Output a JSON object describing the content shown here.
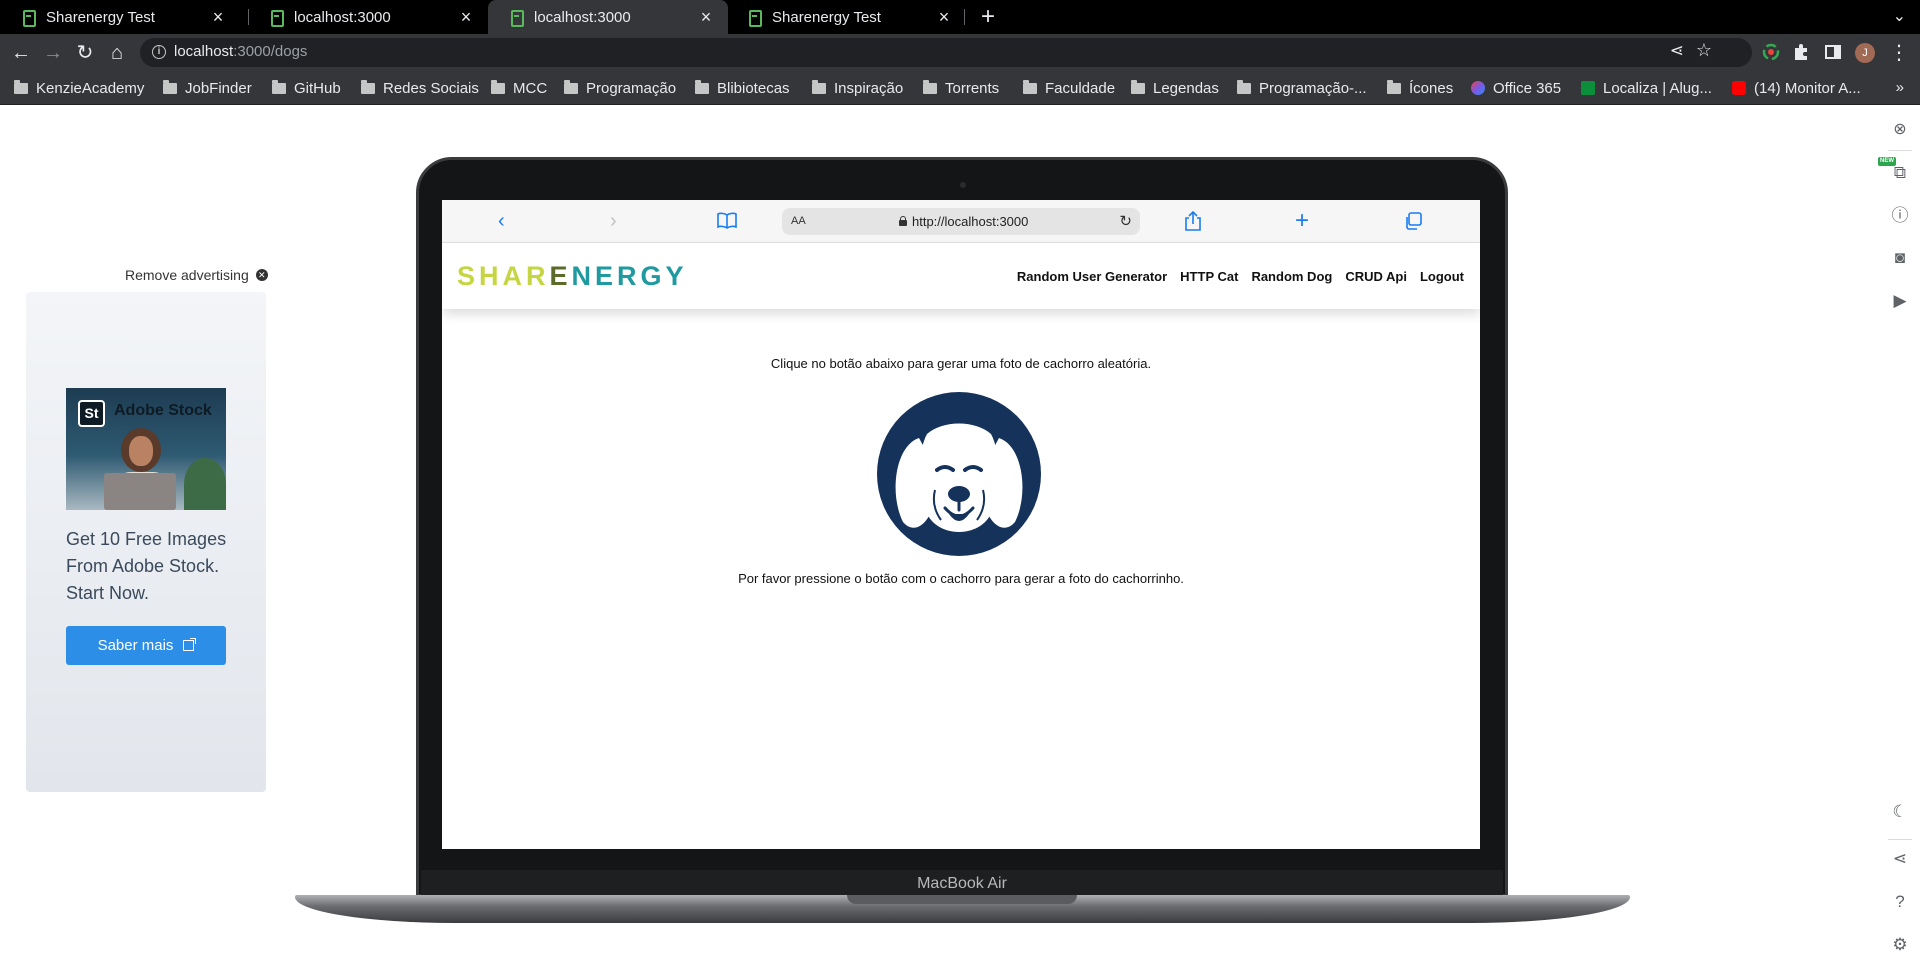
{
  "browser": {
    "tabs": [
      {
        "title": "Sharenergy Test",
        "active": false
      },
      {
        "title": "localhost:3000",
        "active": false
      },
      {
        "title": "localhost:3000",
        "active": true
      },
      {
        "title": "Sharenergy Test",
        "active": false
      }
    ],
    "address": {
      "host": "localhost",
      "path": ":3000/dogs"
    },
    "avatar_letter": "J",
    "bookmarks": [
      "KenzieAcademy",
      "JobFinder",
      "GitHub",
      "Redes Sociais",
      "MCC",
      "Programação",
      "Blibiotecas",
      "Inspiração",
      "Torrents",
      "Faculdade",
      "Legendas",
      "Programação-...",
      "Ícones",
      "Office 365",
      "Localiza | Alug...",
      "(14) Monitor A..."
    ],
    "bookmarks_more": "»"
  },
  "ad": {
    "remove_label": "Remove advertising",
    "brand_badge": "St",
    "brand_name": "Adobe Stock",
    "text": "Get 10 Free Images From Adobe Stock. Start Now.",
    "button_label": "Saber mais"
  },
  "device": {
    "label": "MacBook Air"
  },
  "safari": {
    "aa_label": "AA",
    "url": "http://localhost:3000"
  },
  "site": {
    "logo_part1": "SHAR",
    "logo_part2": "E",
    "logo_part3": "NERGY",
    "menu": [
      "Random User Generator",
      "HTTP Cat",
      "Random Dog",
      "CRUD Api",
      "Logout"
    ],
    "instruction": "Clique no botão abaixo para gerar uma foto de cachorro aleatória.",
    "prompt": "Por favor pressione o botão com o cachorro para gerar a foto do cachorrinho."
  },
  "side_panel": {
    "badge": "NEW"
  },
  "colors": {
    "chrome_dark": "#35363a",
    "logo_green": "#c6d642",
    "logo_teal": "#1f9aa0",
    "dog_navy": "#14325a",
    "ad_button": "#2d8ee8"
  }
}
